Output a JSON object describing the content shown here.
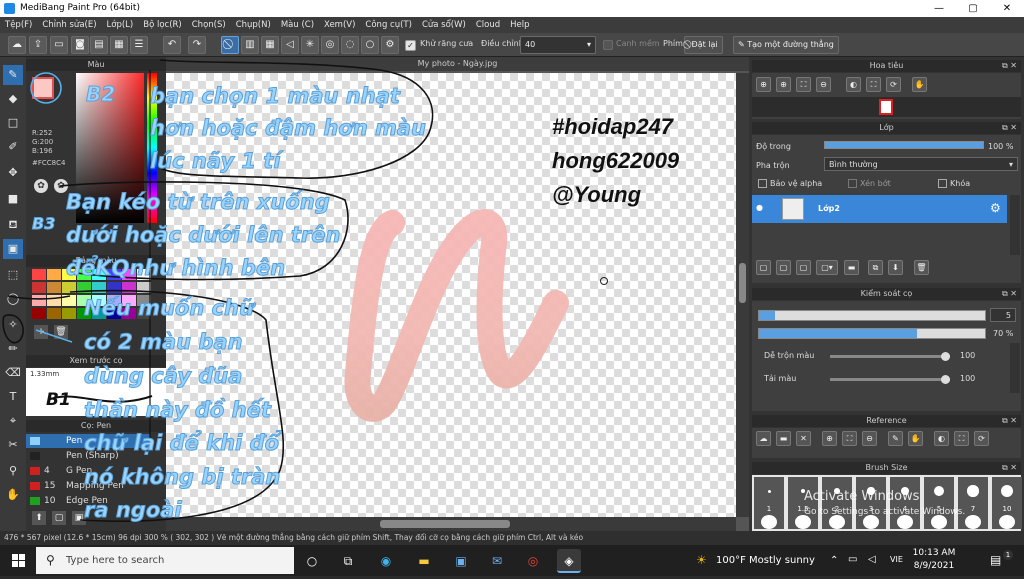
{
  "window": {
    "title": "MediBang Paint Pro (64bit)",
    "minimize": "—",
    "maximize": "▢",
    "close": "✕"
  },
  "menu": [
    "Tệp(F)",
    "Chỉnh sửa(E)",
    "Lớp(L)",
    "Bộ lọc(R)",
    "Chọn(S)",
    "Chụp(N)",
    "Màu (C)",
    "Xem(V)",
    "Công cụ(T)",
    "Cửa sổ(W)",
    "Cloud",
    "Help"
  ],
  "toolbar": {
    "antialias_label": "Khử răng cưa",
    "adjust_label": "Điều chỉnh",
    "adjust_value": "40",
    "smooth_label": "Canh mềm",
    "phim_label": "Phím",
    "reset_button": "Đặt lại",
    "straight_line_button": "Tạo một đường thẳng"
  },
  "left_panel": {
    "color_header": "Màu",
    "rgb": {
      "r": "R:252",
      "g": "G:200",
      "b": "B:196"
    },
    "hex": "#FCC8C4",
    "palette_header": "Bảng màu",
    "preview_header": "Xem trước cọ",
    "brush_size": "1.33mm",
    "brush_header": "Cọ: Pen",
    "brushes": [
      {
        "num": "",
        "name": "Pen",
        "color": "#3a86d8"
      },
      {
        "num": "",
        "name": "Pen (Sharp)",
        "color": "#222222"
      },
      {
        "num": "4",
        "name": "G Pen",
        "color": "#d02020"
      },
      {
        "num": "15",
        "name": "Mapping Pen",
        "color": "#d02020"
      },
      {
        "num": "10",
        "name": "Edge Pen",
        "color": "#20a020"
      }
    ]
  },
  "canvas": {
    "doc_title": "My photo - Ngày.jpg"
  },
  "right_panel": {
    "navigator_header": "Hoa tiêu",
    "layer_header": "Lớp",
    "opacity_label": "Độ trong",
    "opacity_value": "100 %",
    "opacity_fraction": 1.0,
    "blend_label": "Pha trộn",
    "blend_value": "Bình thường",
    "protect_alpha": "Bảo vệ alpha",
    "clip": "Xén bớt",
    "lock": "Khóa",
    "layer_name": "Lớp2",
    "brush_control_header": "Kiểm soát cọ",
    "brush_size_value": "5",
    "brush_size_fraction": 0.07,
    "brush_opacity_value": "70 %",
    "brush_opacity_fraction": 0.7,
    "blend_color_label": "Dễ trộn màu",
    "blend_color_value": "100",
    "blend_color_fraction": 1.0,
    "paint_color_label": "Tải màu",
    "paint_color_value": "100",
    "paint_color_fraction": 1.0,
    "reference_header": "Reference",
    "brushsize_header": "Brush Size",
    "brushsize_values": [
      "1",
      "1.5",
      "2",
      "3",
      "4",
      "5",
      "7",
      "10"
    ],
    "activate_title": "Activate Windows",
    "activate_sub": "Go to Settings to activate Windows."
  },
  "status": {
    "text": "476 * 567 pixel  (12.6 * 15cm)  96 dpi  300 %  ( 302, 302 )  Vẽ một đường thẳng bằng cách giữ phím Shift, Thay đổi cỡ cọ bằng cách giữ phím Ctrl, Alt và kéo"
  },
  "taskbar": {
    "search_placeholder": "Type here to search",
    "weather": "100°F  Mostly sunny",
    "language": "VIE",
    "time": "10:13 AM",
    "date": "8/9/2021",
    "notification_count": "1"
  },
  "annotations": {
    "b2": "B2",
    "b3": "B3",
    "b1": "B1",
    "note1": [
      "bạn chọn 1 màu nhạt",
      "hơn hoặc đậm hơn màu",
      "lúc nãy 1 tí"
    ],
    "note2": [
      "Bạn kéo từ trên xuống",
      "dưới hoặc dưới lên trên",
      "đểKQnhư hình bên"
    ],
    "note3": [
      "Nếu muốn chữ",
      "có 2 màu bạn",
      "dùng cây đũa",
      "thần này đồ hết",
      "chữ lại để khi đổ",
      "nó không bị tràn",
      "ra ngoài"
    ],
    "signature": [
      "#hoidap247",
      "hong622009",
      "@Young"
    ]
  }
}
